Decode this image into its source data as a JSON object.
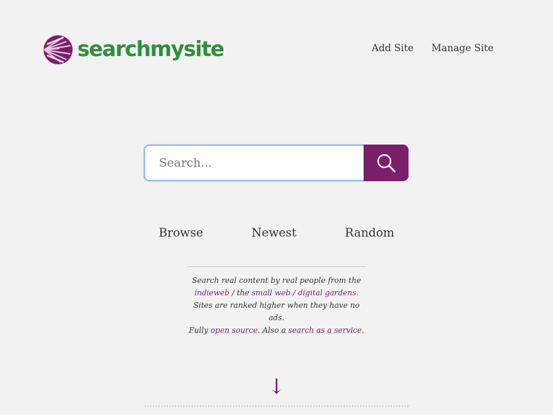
{
  "brand": {
    "name": "searchmysite",
    "color": "#2f8f3c",
    "accent": "#7a1f6a"
  },
  "nav": {
    "add_site": "Add Site",
    "manage_site": "Manage Site"
  },
  "search": {
    "placeholder": "Search...",
    "value": "",
    "button_icon": "search-icon"
  },
  "links": {
    "browse": "Browse",
    "newest": "Newest",
    "random": "Random"
  },
  "blurb": {
    "line1": "Search real content by real people from the",
    "indieweb": "indieweb",
    "sep1": " / the ",
    "small_web": "small web",
    "sep2": " / ",
    "digital_gardens": "digital gardens",
    "end1": ".",
    "line3": "Sites are ranked higher when they have no ads.",
    "fully": "Fully ",
    "open_source": "open source",
    "also": ". Also a ",
    "search_service": "search as a service",
    "end2": "."
  },
  "scroll_arrow": "↓"
}
